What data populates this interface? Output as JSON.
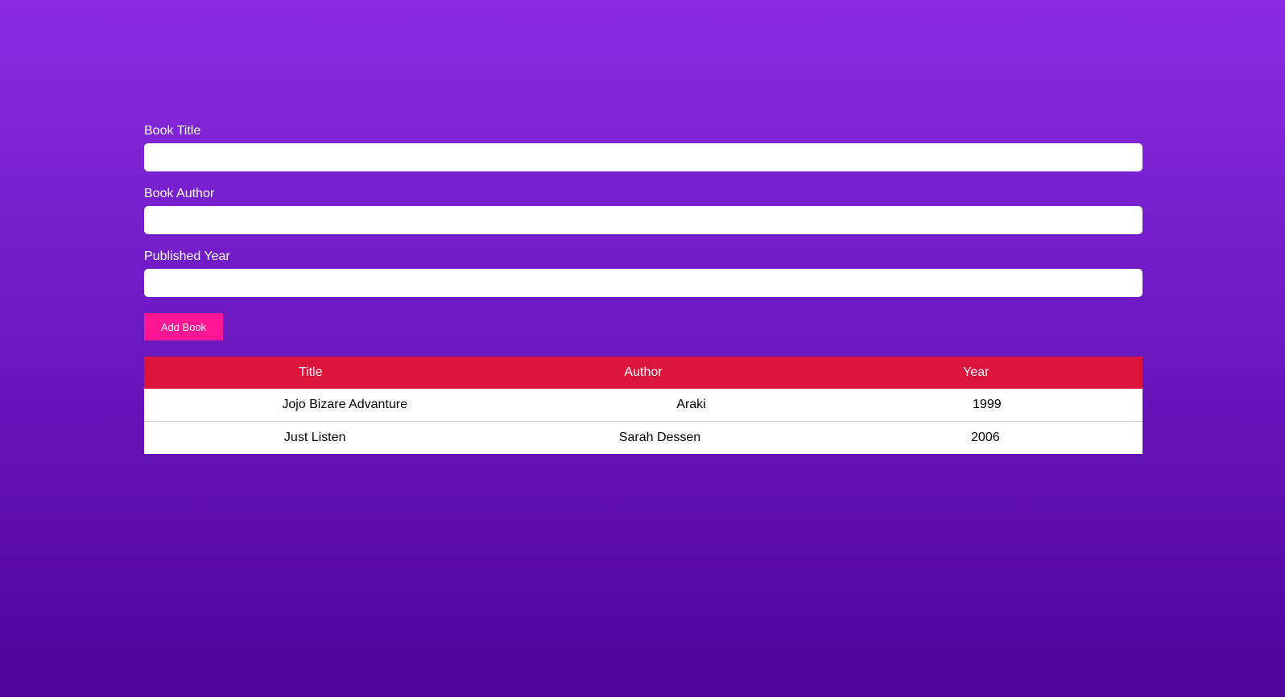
{
  "form": {
    "title_label": "Book Title",
    "title_value": "",
    "author_label": "Book Author",
    "author_value": "",
    "year_label": "Published Year",
    "year_value": "",
    "submit_label": "Add Book"
  },
  "table": {
    "headers": [
      "Title",
      "Author",
      "Year"
    ],
    "rows": [
      [
        "Jojo Bizare Advanture",
        "Araki",
        "1999"
      ],
      [
        "Just Listen",
        "Sarah Dessen",
        "2006"
      ]
    ]
  },
  "colors": {
    "header": "#dc143c",
    "button": "#ff1493",
    "gradient_top": "#8a2be2",
    "gradient_bottom": "#4f0399"
  }
}
